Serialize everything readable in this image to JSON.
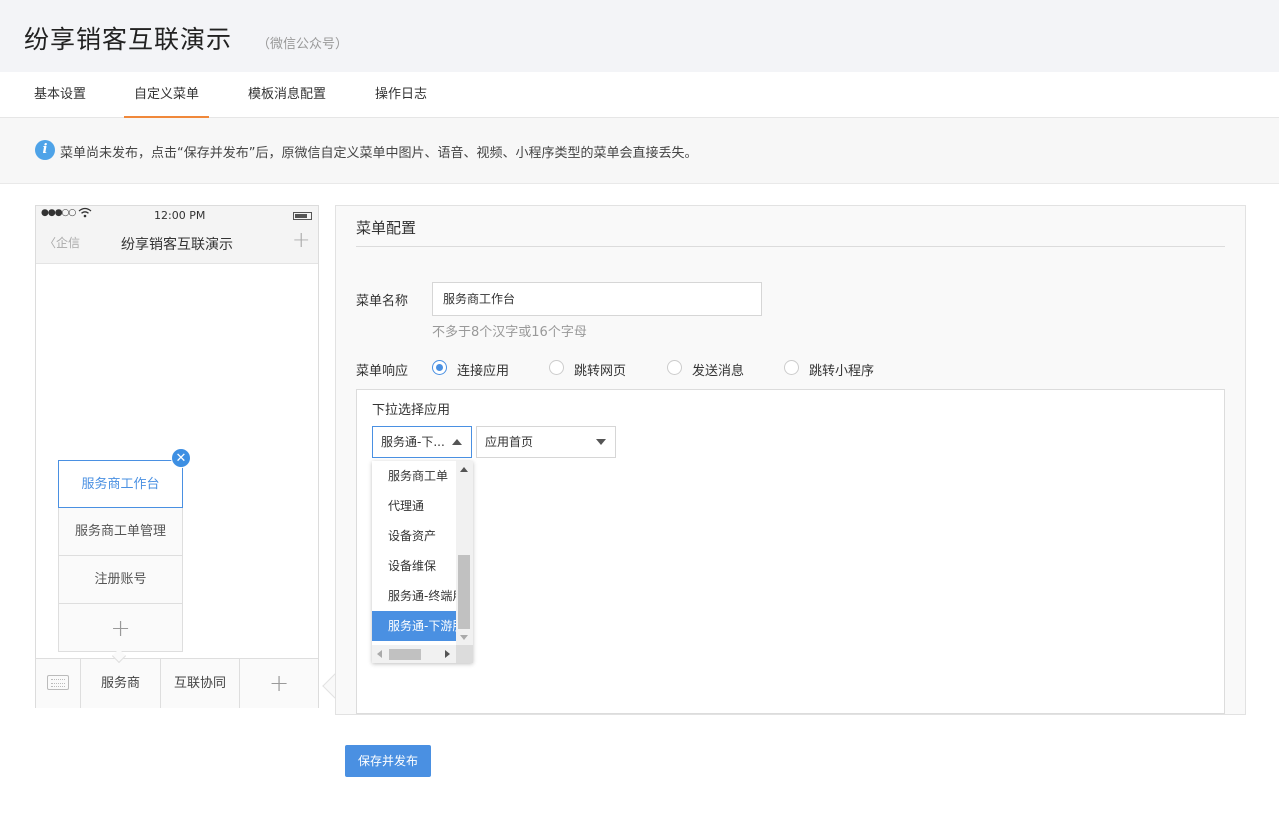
{
  "header": {
    "title": "纷享销客互联演示",
    "subtitle": "（微信公众号）"
  },
  "tabs": [
    {
      "label": "基本设置",
      "active": false
    },
    {
      "label": "自定义菜单",
      "active": true
    },
    {
      "label": "模板消息配置",
      "active": false
    },
    {
      "label": "操作日志",
      "active": false
    }
  ],
  "notice": {
    "icon": "info-icon",
    "text": "菜单尚未发布，点击“保存并发布”后，原微信自定义菜单中图片、语音、视频、小程序类型的菜单会直接丢失。"
  },
  "phone": {
    "signal": "●●●○○",
    "time": "12:00 PM",
    "back_label": "企信",
    "nav_title": "纷享销客互联演示",
    "submenu": [
      "服务商工作台",
      "服务商工单管理",
      "注册账号"
    ],
    "menubar": [
      "服务商",
      "互联协同"
    ]
  },
  "config": {
    "title": "菜单配置",
    "name_label": "菜单名称",
    "name_value": "服务商工作台",
    "name_hint": "不多于8个汉字或16个字母",
    "response_label": "菜单响应",
    "response_options": [
      {
        "label": "连接应用",
        "checked": true
      },
      {
        "label": "跳转网页",
        "checked": false
      },
      {
        "label": "发送消息",
        "checked": false
      },
      {
        "label": "跳转小程序",
        "checked": false
      }
    ],
    "app_panel_title": "下拉选择应用",
    "app_select_value": "服务通-下...",
    "page_select_value": "应用首页",
    "dropdown_options": [
      {
        "label": "服务商工单",
        "selected": false
      },
      {
        "label": "代理通",
        "selected": false
      },
      {
        "label": "设备资产",
        "selected": false
      },
      {
        "label": "设备维保",
        "selected": false
      },
      {
        "label": "服务通-终端用户",
        "selected": false
      },
      {
        "label": "服务通-下游服务商",
        "selected": true
      }
    ]
  },
  "publish_button": "保存并发布",
  "colors": {
    "accent": "#4a90e2",
    "tab_underline": "#f0883a",
    "header_bg": "#f3f4f7"
  }
}
